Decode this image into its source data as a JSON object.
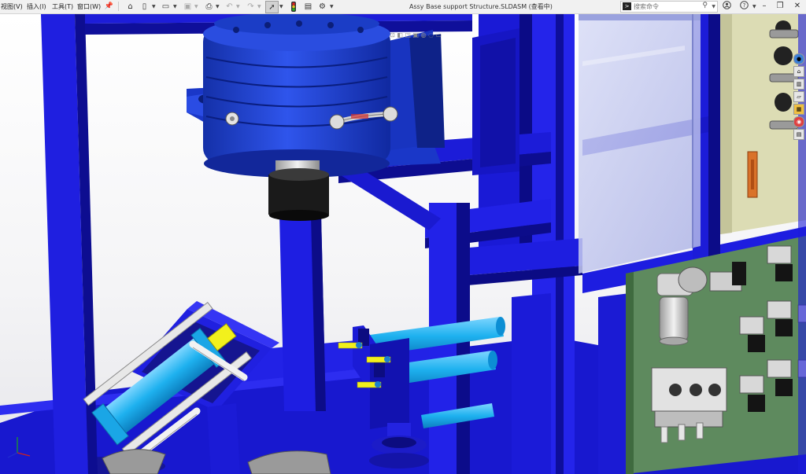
{
  "menu": {
    "view": "视图(V)",
    "insert": "插入(I)",
    "tools": "工具(T)",
    "window": "窗口(W)"
  },
  "title": "Assy Base support Structure.SLDASM (查看中)",
  "search": {
    "prompt_icon": ">",
    "placeholder": "搜索命令"
  },
  "toolbar_icons": [
    "pin-icon",
    "home-icon",
    "new-document-icon",
    "open-icon",
    "save-icon",
    "print-icon",
    "undo-icon",
    "redo-icon",
    "select-pointer-icon",
    "traffic-light-icon",
    "file-properties-icon",
    "options-gear-icon"
  ],
  "taskpane_icons": [
    "solidworks-resources-icon",
    "design-library-icon",
    "file-explorer-icon",
    "view-palette-icon",
    "appearances-icon",
    "custom-properties-icon"
  ],
  "colors": {
    "frame_blue": "#1a1adf",
    "frame_blue_dark": "#0b0b8c",
    "motor_blue": "#1c3bd6",
    "cyan": "#1fb0ee",
    "yellow": "#f2f01c",
    "panel_green": "#5e8a5e",
    "khaki": "#dcdcb4",
    "glass": "#c8cdf0"
  }
}
